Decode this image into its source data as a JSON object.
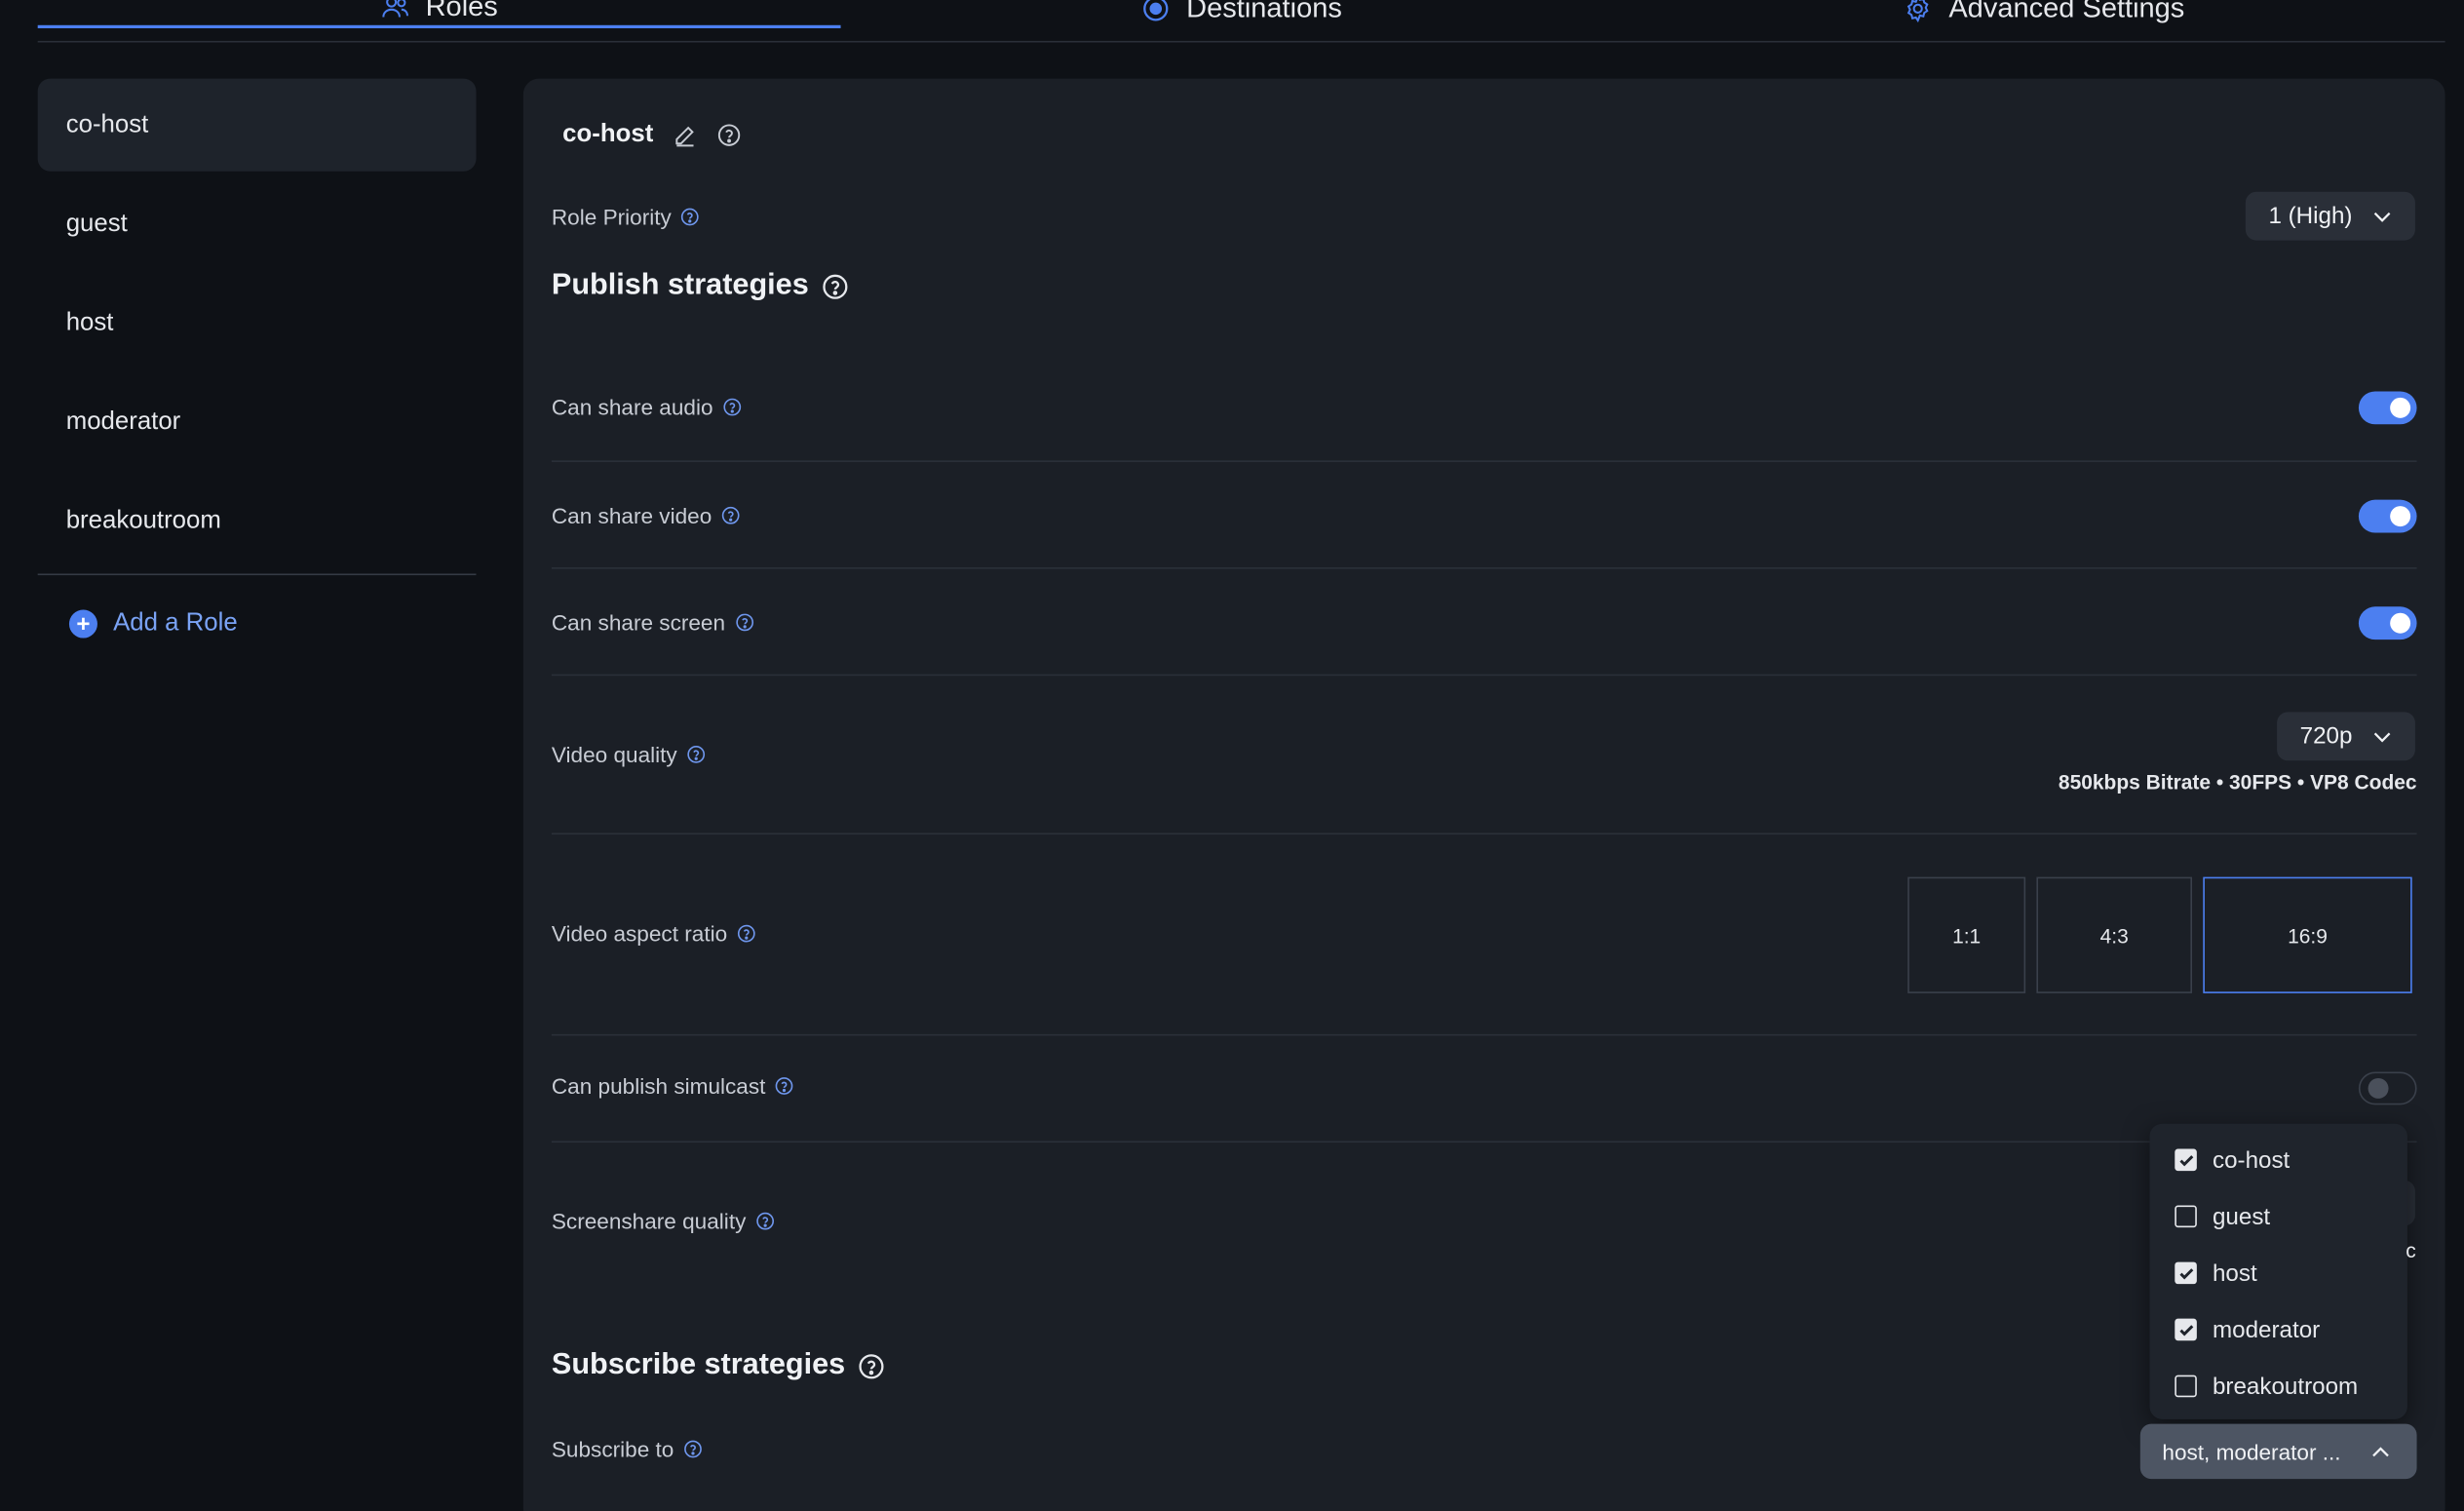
{
  "tabs": [
    {
      "label": "Roles",
      "icon": "users-icon"
    },
    {
      "label": "Destinations",
      "icon": "record-icon"
    },
    {
      "label": "Advanced Settings",
      "icon": "gear-icon"
    }
  ],
  "sidebar": {
    "items": [
      {
        "label": "co-host"
      },
      {
        "label": "guest"
      },
      {
        "label": "host"
      },
      {
        "label": "moderator"
      },
      {
        "label": "breakoutroom"
      }
    ],
    "add_role_label": "Add a Role"
  },
  "role": {
    "name": "co-host",
    "priority_label": "Role Priority",
    "priority_value": "1 (High)"
  },
  "publish": {
    "title": "Publish strategies",
    "share_audio_label": "Can share audio",
    "share_audio": true,
    "share_video_label": "Can share video",
    "share_video": true,
    "share_screen_label": "Can share screen",
    "share_screen": true,
    "video_quality_label": "Video quality",
    "video_quality_value": "720p",
    "video_quality_details": "850kbps Bitrate • 30FPS • VP8 Codec",
    "aspect_ratio_label": "Video aspect ratio",
    "aspect_ratios": [
      "1:1",
      "4:3",
      "16:9"
    ],
    "aspect_ratio_selected": "16:9",
    "simulcast_label": "Can publish simulcast",
    "simulcast": false,
    "screenshare_quality_label": "Screenshare quality"
  },
  "subscribe": {
    "title": "Subscribe strategies",
    "subscribe_to_label": "Subscribe to",
    "subscribe_to_value": "host, moderator ...",
    "options": [
      {
        "label": "co-host",
        "checked": true
      },
      {
        "label": "guest",
        "checked": false
      },
      {
        "label": "host",
        "checked": true
      },
      {
        "label": "moderator",
        "checked": true
      },
      {
        "label": "breakoutroom",
        "checked": false
      }
    ]
  },
  "colors": {
    "accent": "#4c7ff0",
    "background": "#0e1116",
    "panel": "#1b1f26"
  }
}
